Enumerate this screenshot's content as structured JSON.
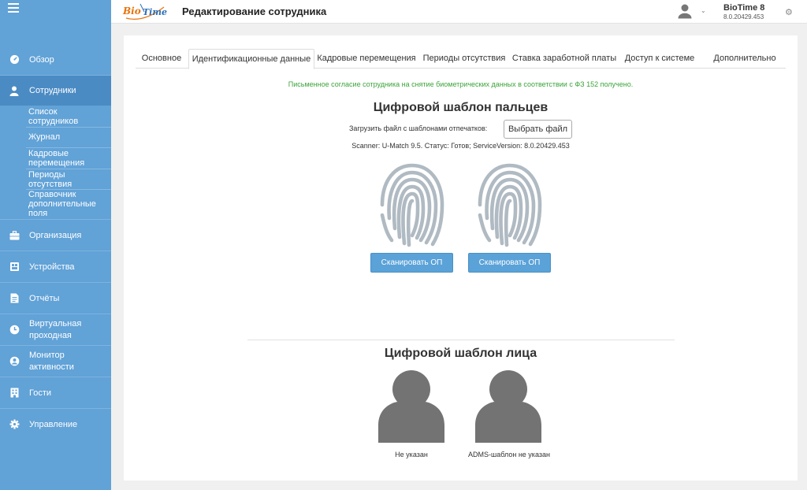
{
  "sidebar": {
    "items": [
      {
        "label": "Обзор",
        "icon": "dashboard-icon"
      },
      {
        "label": "Сотрудники",
        "icon": "person-icon"
      },
      {
        "label": "Организация",
        "icon": "briefcase-icon"
      },
      {
        "label": "Устройства",
        "icon": "device-icon"
      },
      {
        "label": "Отчёты",
        "icon": "report-icon"
      },
      {
        "label": "Виртуальная проходная",
        "icon": "clock-icon"
      },
      {
        "label": "Монитор активности",
        "icon": "user-circle-icon"
      },
      {
        "label": "Гости",
        "icon": "building-icon"
      },
      {
        "label": "Управление",
        "icon": "gear-icon"
      }
    ],
    "subitems": [
      "Список сотрудников",
      "Журнал",
      "Кадровые перемещения",
      "Периоды отсутствия",
      "Справочник дополнительные поля"
    ]
  },
  "header": {
    "logo_bio": "Bio",
    "logo_time": "Time",
    "title": "Редактирование сотрудника",
    "app_name": "BioTime 8",
    "app_version": "8.0.20429.453"
  },
  "tabs": [
    "Основное",
    "Идентификационные данные",
    "Кадровые перемещения",
    "Периоды отсутствия",
    "Ставка заработной платы",
    "Доступ к системе",
    "Дополнительно"
  ],
  "consent": "Письменное согласие сотрудника на снятие биометрических данных в соответствии с ФЗ 152 получено.",
  "fingerprint": {
    "title": "Цифровой шаблон пальцев",
    "upload_label": "Загрузить файл с шаблонами отпечатков:",
    "upload_button": "Выбрать файл",
    "scanner_status": "Scanner: U-Match 9.5. Статус: Готов; ServiceVersion: 8.0.20429.453",
    "scan_button_1": "Сканировать ОП",
    "scan_button_2": "Сканировать ОП"
  },
  "face": {
    "title": "Цифровой шаблон лица",
    "caption_1": "Не указан",
    "caption_2": "ADMS-шаблон не указан"
  },
  "colors": {
    "sidebar": "#61a2d7",
    "sidebar_active": "#4b8bc4",
    "button": "#5aa2d8",
    "consent_text": "#3aa43a",
    "icon_gray": "#b0bac2",
    "face_gray": "#737373"
  }
}
